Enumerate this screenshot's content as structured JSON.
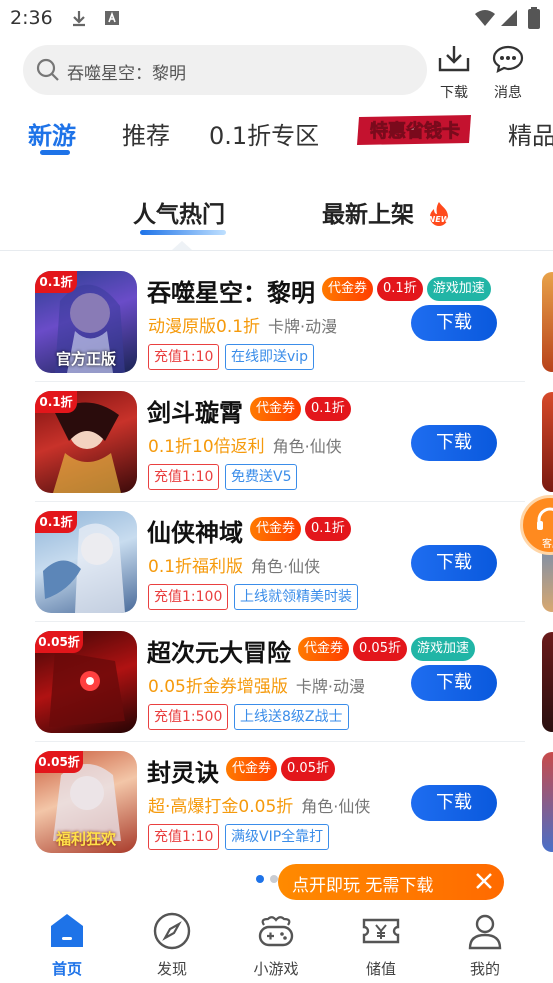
{
  "status_bar": {
    "time": "2:36"
  },
  "search": {
    "placeholder": "吞噬星空：黎明"
  },
  "top_actions": {
    "download_label": "下载",
    "messages_label": "消息"
  },
  "tabs": [
    {
      "label": "新游",
      "active": true
    },
    {
      "label": "推荐"
    },
    {
      "label": "0.1折专区"
    },
    {
      "label": "特惠省钱卡"
    },
    {
      "label": "精品"
    }
  ],
  "subtabs": [
    {
      "label": "人气热门",
      "active": true
    },
    {
      "label": "最新上架",
      "badge": "NEW"
    }
  ],
  "games": [
    {
      "name": "吞噬星空：黎明",
      "cover_badge": "0.1折",
      "cover_caption": "官方正版",
      "tags": [
        "代金券",
        "0.1折",
        "游戏加速"
      ],
      "desc": "动漫原版0.1折",
      "genre": "卡牌·动漫",
      "recharge": "充值1:10",
      "perk": "在线即送vip",
      "button": "下载"
    },
    {
      "name": "剑斗璇霄",
      "cover_badge": "0.1折",
      "cover_caption": "",
      "tags": [
        "代金券",
        "0.1折"
      ],
      "desc": "0.1折10倍返利",
      "genre": "角色·仙侠",
      "recharge": "充值1:10",
      "perk": "免费送V5",
      "button": "下载"
    },
    {
      "name": "仙侠神域",
      "cover_badge": "0.1折",
      "cover_caption": "",
      "tags": [
        "代金券",
        "0.1折"
      ],
      "desc": "0.1折福利版",
      "genre": "角色·仙侠",
      "recharge": "充值1:100",
      "perk": "上线就领精美时装",
      "button": "下载"
    },
    {
      "name": "超次元大冒险",
      "cover_badge": "0.05折",
      "cover_caption": "",
      "tags": [
        "代金券",
        "0.05折",
        "游戏加速"
      ],
      "desc": "0.05折金券增强版",
      "genre": "卡牌·动漫",
      "recharge": "充值1:500",
      "perk": "上线送8级Z战士",
      "button": "下载"
    },
    {
      "name": "封灵诀",
      "cover_badge": "0.05折",
      "cover_caption": "福利狂欢",
      "tags": [
        "代金券",
        "0.05折"
      ],
      "desc": "超·高爆打金0.05折",
      "genre": "角色·仙侠",
      "recharge": "充值1:10",
      "perk": "满级VIP全靠打",
      "button": "下载"
    }
  ],
  "float_button": {
    "label": "客服"
  },
  "banner": {
    "text": "点开即玩 无需下载"
  },
  "bottom_nav": [
    {
      "label": "首页",
      "active": true
    },
    {
      "label": "发现"
    },
    {
      "label": "小游戏"
    },
    {
      "label": "储值"
    },
    {
      "label": "我的"
    }
  ],
  "colors": {
    "accent": "#1e73e8",
    "orange": "#ff7a00",
    "red": "#e3161b",
    "teal": "#21b5a6"
  }
}
